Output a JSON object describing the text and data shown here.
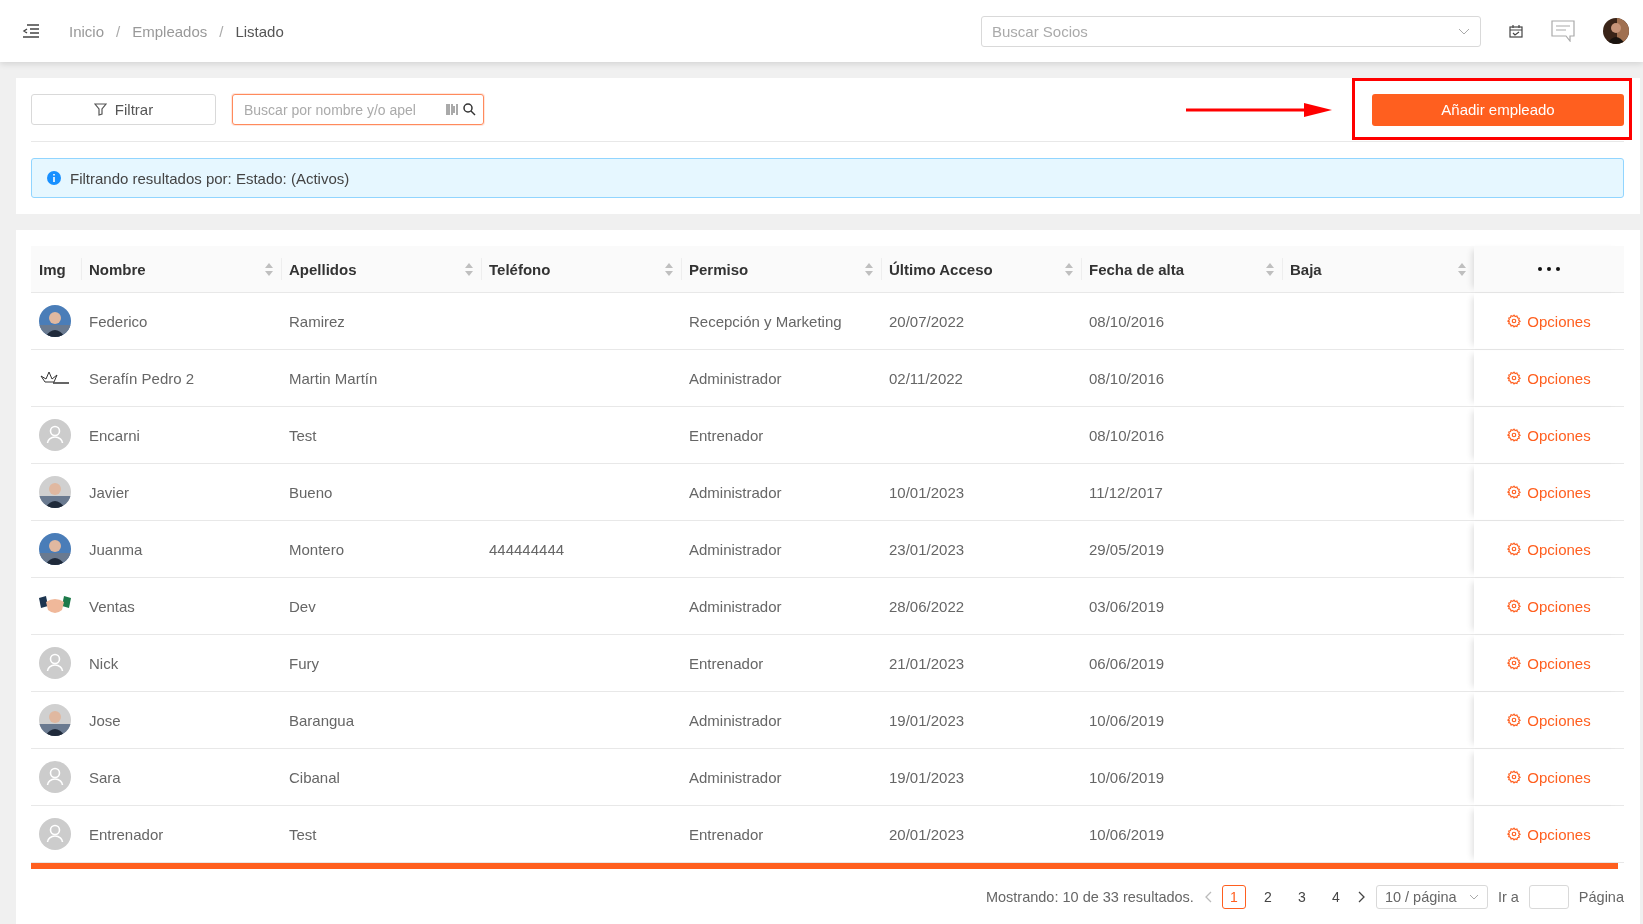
{
  "topbar": {
    "breadcrumb": [
      "Inicio",
      "/",
      "Empleados",
      "/",
      "Listado"
    ],
    "search": {
      "placeholder": "Buscar Socios"
    }
  },
  "toolbar": {
    "filter_button": "Filtrar",
    "search": {
      "placeholder": "Buscar por nombre y/o apel"
    },
    "add_button": "Añadir empleado"
  },
  "alert": "Filtrando resultados por: Estado: (Activos)",
  "table": {
    "columns": [
      {
        "label": "Img",
        "sortable": false
      },
      {
        "label": "Nombre",
        "sortable": true
      },
      {
        "label": "Apellidos",
        "sortable": true
      },
      {
        "label": "Teléfono",
        "sortable": true
      },
      {
        "label": "Permiso",
        "sortable": true
      },
      {
        "label": "Último Acceso",
        "sortable": true
      },
      {
        "label": "Fecha de alta",
        "sortable": true
      },
      {
        "label": "Baja",
        "sortable": true
      }
    ],
    "rows": [
      {
        "nombre": "Federico",
        "apellidos": "Ramirez",
        "permiso": "Recepción y Marketing",
        "ultimo_acceso": "20/07/2022",
        "fecha_alta": "08/10/2016",
        "action": "Opciones"
      },
      {
        "kind": "logo",
        "nombre": "Serafín Pedro 2",
        "apellidos": "Martin Martín",
        "permiso": "Administrador",
        "ultimo_acceso": "02/11/2022",
        "fecha_alta": "08/10/2016",
        "action": "Opciones"
      },
      {
        "kind": "default",
        "nombre": "Encarni",
        "apellidos": "Test",
        "permiso": "Entrenador",
        "fecha_alta": "08/10/2016",
        "action": "Opciones"
      },
      {
        "nombre": "Javier",
        "apellidos": "Bueno",
        "permiso": "Administrador",
        "ultimo_acceso": "10/01/2023",
        "fecha_alta": "11/12/2017",
        "action": "Opciones"
      },
      {
        "nombre": "Juanma",
        "apellidos": "Montero",
        "telefono": "444444444",
        "permiso": "Administrador",
        "ultimo_acceso": "23/01/2023",
        "fecha_alta": "29/05/2019",
        "action": "Opciones"
      },
      {
        "kind": "handshake",
        "nombre": "Ventas",
        "apellidos": "Dev",
        "permiso": "Administrador",
        "ultimo_acceso": "28/06/2022",
        "fecha_alta": "03/06/2019",
        "action": "Opciones"
      },
      {
        "kind": "default",
        "nombre": "Nick",
        "apellidos": "Fury",
        "permiso": "Entrenador",
        "ultimo_acceso": "21/01/2023",
        "fecha_alta": "06/06/2019",
        "action": "Opciones"
      },
      {
        "nombre": "Jose",
        "apellidos": "Barangua",
        "permiso": "Administrador",
        "ultimo_acceso": "19/01/2023",
        "fecha_alta": "10/06/2019",
        "action": "Opciones"
      },
      {
        "kind": "default",
        "nombre": "Sara",
        "apellidos": "Cibanal",
        "permiso": "Administrador",
        "ultimo_acceso": "19/01/2023",
        "fecha_alta": "10/06/2019",
        "action": "Opciones"
      },
      {
        "kind": "default",
        "nombre": "Entrenador",
        "apellidos": "Test",
        "permiso": "Entrenador",
        "ultimo_acceso": "20/01/2023",
        "fecha_alta": "10/06/2019",
        "action": "Opciones"
      }
    ]
  },
  "pagination": {
    "summary": "Mostrando: 10 de 33 resultados.",
    "pages": [
      {
        "label": "1",
        "selected": true
      },
      {
        "label": "2",
        "selected": false
      },
      {
        "label": "3",
        "selected": false
      },
      {
        "label": "4",
        "selected": false
      }
    ],
    "page_size": "10 / página",
    "goto_label": "Ir a",
    "page_label": "Página"
  }
}
